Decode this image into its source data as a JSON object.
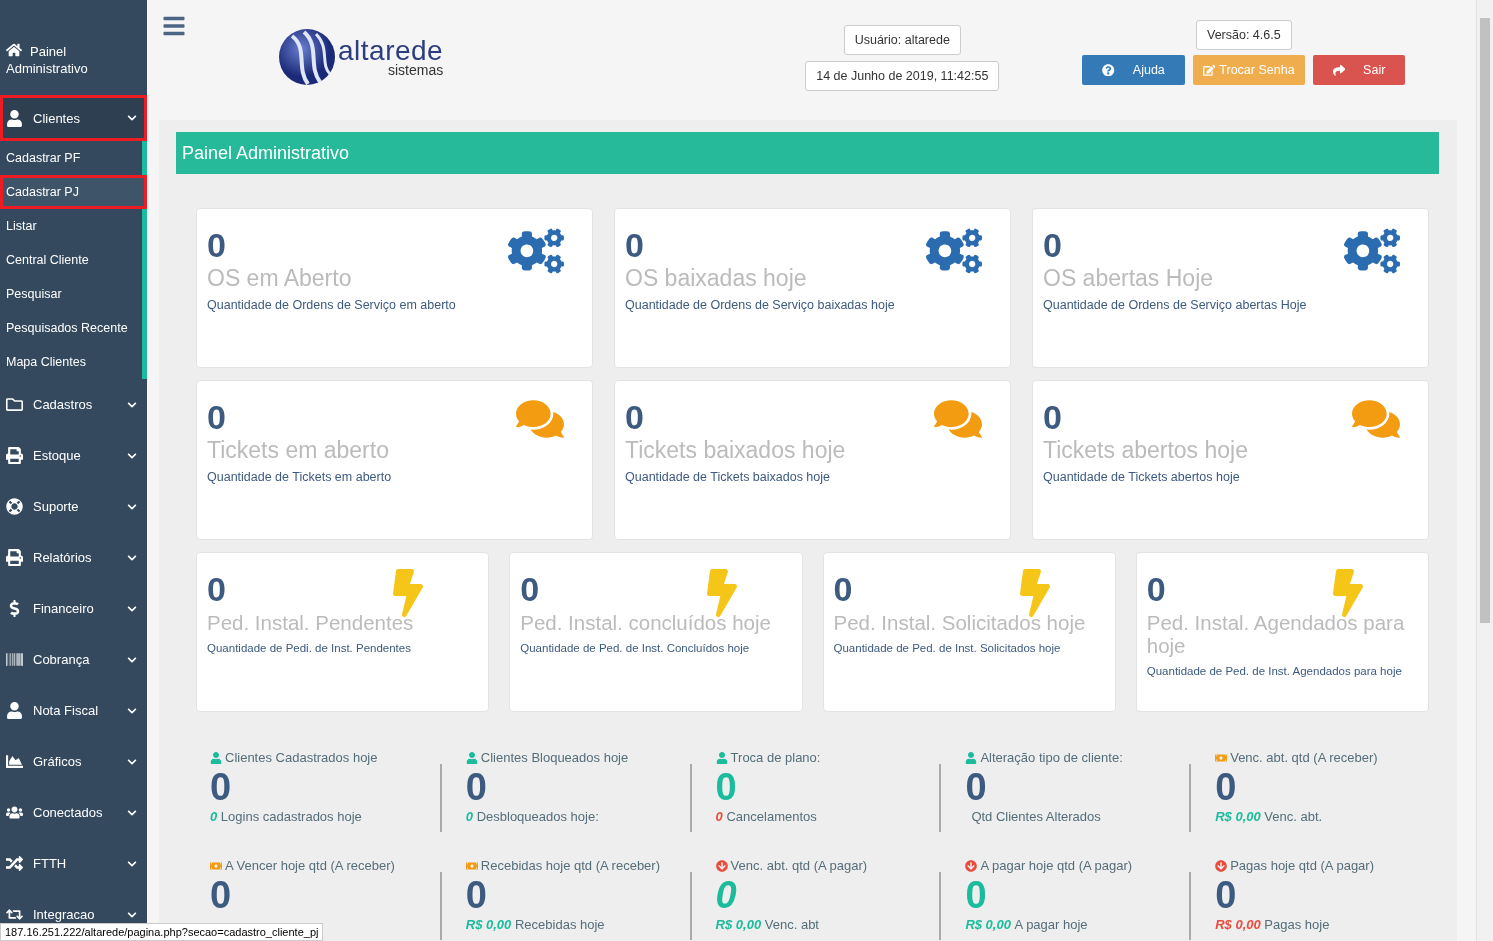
{
  "sidebar": {
    "top": {
      "kind": "home",
      "label": "Painel Administrativo"
    },
    "items": [
      {
        "kind": "user",
        "label": "Clientes",
        "expanded": true,
        "highlighted": true,
        "children": [
          {
            "label": "Cadastrar PF",
            "selected": false,
            "highlighted": false
          },
          {
            "label": "Cadastrar PJ",
            "selected": true,
            "highlighted": true
          },
          {
            "label": "Listar",
            "selected": false,
            "highlighted": false
          },
          {
            "label": "Central Cliente",
            "selected": false,
            "highlighted": false
          },
          {
            "label": "Pesquisar",
            "selected": false,
            "highlighted": false
          },
          {
            "label": "Pesquisados Recente",
            "selected": false,
            "highlighted": false
          },
          {
            "label": "Mapa Clientes",
            "selected": false,
            "highlighted": false
          }
        ]
      },
      {
        "kind": "folder",
        "label": "Cadastros",
        "expanded": false,
        "highlighted": false
      },
      {
        "kind": "print",
        "label": "Estoque",
        "expanded": false,
        "highlighted": false
      },
      {
        "kind": "lifering",
        "label": "Suporte",
        "expanded": false,
        "highlighted": false
      },
      {
        "kind": "print",
        "label": "Relatórios",
        "expanded": false,
        "highlighted": false
      },
      {
        "kind": "dollar",
        "label": "Financeiro",
        "expanded": false,
        "highlighted": false
      },
      {
        "kind": "barcode",
        "label": "Cobrança",
        "expanded": false,
        "highlighted": false
      },
      {
        "kind": "user",
        "label": "Nota Fiscal",
        "expanded": false,
        "highlighted": false
      },
      {
        "kind": "chart",
        "label": "Gráficos",
        "expanded": false,
        "highlighted": false
      },
      {
        "kind": "users",
        "label": "Conectados",
        "expanded": false,
        "highlighted": false
      },
      {
        "kind": "random",
        "label": "FTTH",
        "expanded": false,
        "highlighted": false
      },
      {
        "kind": "retweet",
        "label": "Integracao",
        "expanded": false,
        "highlighted": false
      }
    ]
  },
  "header": {
    "logo": {
      "name": "altarede",
      "tagline": "sistemas"
    },
    "user": "Usuário: altarede",
    "datetime": "14 de Junho de 2019, 11:42:55",
    "version": "Versão: 4.6.5",
    "buttons": [
      {
        "kind": "help",
        "label": "Ajuda"
      },
      {
        "kind": "password",
        "label": "Trocar Senha"
      },
      {
        "kind": "logout",
        "label": "Sair"
      }
    ]
  },
  "panel": {
    "title": "Painel Administrativo",
    "card_rows": [
      [
        {
          "kind": "gears",
          "value": "0",
          "title": "OS em Aberto",
          "description": "Quantidade de Ordens de Serviço em aberto"
        },
        {
          "kind": "gears",
          "value": "0",
          "title": "OS baixadas hoje",
          "description": "Quantidade de Ordens de Serviço baixadas hoje"
        },
        {
          "kind": "gears",
          "value": "0",
          "title": "OS abertas Hoje",
          "description": "Quantidade de Ordens de Serviço abertas Hoje"
        }
      ],
      [
        {
          "kind": "chat",
          "value": "0",
          "title": "Tickets em aberto",
          "description": "Quantidade de Tickets em aberto"
        },
        {
          "kind": "chat",
          "value": "0",
          "title": "Tickets baixados hoje",
          "description": "Quantidade de Tickets baixados hoje"
        },
        {
          "kind": "chat",
          "value": "0",
          "title": "Tickets abertos hoje",
          "description": "Quantidade de Tickets abertos hoje"
        }
      ],
      [
        {
          "kind": "bolt",
          "value": "0",
          "title": "Ped. Instal. Pendentes",
          "description": "Quantidade de Pedi. de Inst. Pendentes"
        },
        {
          "kind": "bolt",
          "value": "0",
          "title": "Ped. Instal. concluídos hoje",
          "description": "Quantidade de Ped. de Inst. Concluídos hoje"
        },
        {
          "kind": "bolt",
          "value": "0",
          "title": "Ped. Instal. Solicitados hoje",
          "description": "Quantidade de Ped. de Inst. Solicitados hoje"
        },
        {
          "kind": "bolt",
          "value": "0",
          "title": "Ped. Instal. Agendados para hoje",
          "description": "Quantidade de Ped. de Inst. Agendados para hoje"
        }
      ]
    ],
    "stat_rows": [
      [
        {
          "kind": "user",
          "title": "Clientes Cadastrados hoje",
          "value": "0",
          "color": "#3d5a80",
          "italic": false,
          "note": {
            "value": "0",
            "color": "#1abc9c",
            "text": "Logins cadastrados hoje"
          }
        },
        {
          "kind": "user",
          "title": "Clientes Bloqueados hoje",
          "value": "0",
          "color": "#3d5a80",
          "italic": false,
          "note": {
            "value": "0",
            "color": "#1abc9c",
            "text": "Desbloqueados hoje:"
          }
        },
        {
          "kind": "user",
          "title": "Troca de plano:",
          "value": "0",
          "color": "#1abc9c",
          "italic": false,
          "note": {
            "value": "0",
            "color": "#e74c3c",
            "text": "Cancelamentos"
          }
        },
        {
          "kind": "user",
          "title": "Alteração tipo de cliente:",
          "value": "0",
          "color": "#3d5a80",
          "italic": false,
          "note": {
            "text": "Qtd Clientes Alterados"
          }
        },
        {
          "kind": "money",
          "title": "Venc. abt. qtd (A receber)",
          "value": "0",
          "color": "#3d5a80",
          "italic": false,
          "note": {
            "value": "R$ 0,00",
            "color": "#1abc9c",
            "text": "Venc. abt."
          }
        }
      ],
      [
        {
          "kind": "money",
          "title": "A Vencer hoje qtd (A receber)",
          "value": "0",
          "color": "#3d5a80",
          "italic": false
        },
        {
          "kind": "money",
          "title": "Recebidas hoje qtd (A receber)",
          "value": "0",
          "color": "#3d5a80",
          "italic": false,
          "note": {
            "value": "R$ 0,00",
            "color": "#1abc9c",
            "text": "Recebidas hoje"
          }
        },
        {
          "kind": "down",
          "title": "Venc. abt. qtd (A pagar)",
          "value": "0",
          "color": "#1abc9c",
          "italic": true,
          "note": {
            "value": "R$ 0,00",
            "color": "#1abc9c",
            "text": "Venc. abt"
          }
        },
        {
          "kind": "down",
          "title": "A pagar hoje qtd (A pagar)",
          "value": "0",
          "color": "#1abc9c",
          "italic": false,
          "note": {
            "value": "R$ 0,00",
            "color": "#1abc9c",
            "text": "A pagar hoje"
          }
        },
        {
          "kind": "down",
          "title": "Pagas hoje qtd (A pagar)",
          "value": "0",
          "color": "#3d5a80",
          "italic": false,
          "note": {
            "value": "R$ 0,00",
            "color": "#e74c3c",
            "text": "Pagas hoje"
          }
        }
      ]
    ]
  },
  "status_bar": "187.16.251.222/altarede/pagina.php?secao=cadastro_cliente_pj"
}
